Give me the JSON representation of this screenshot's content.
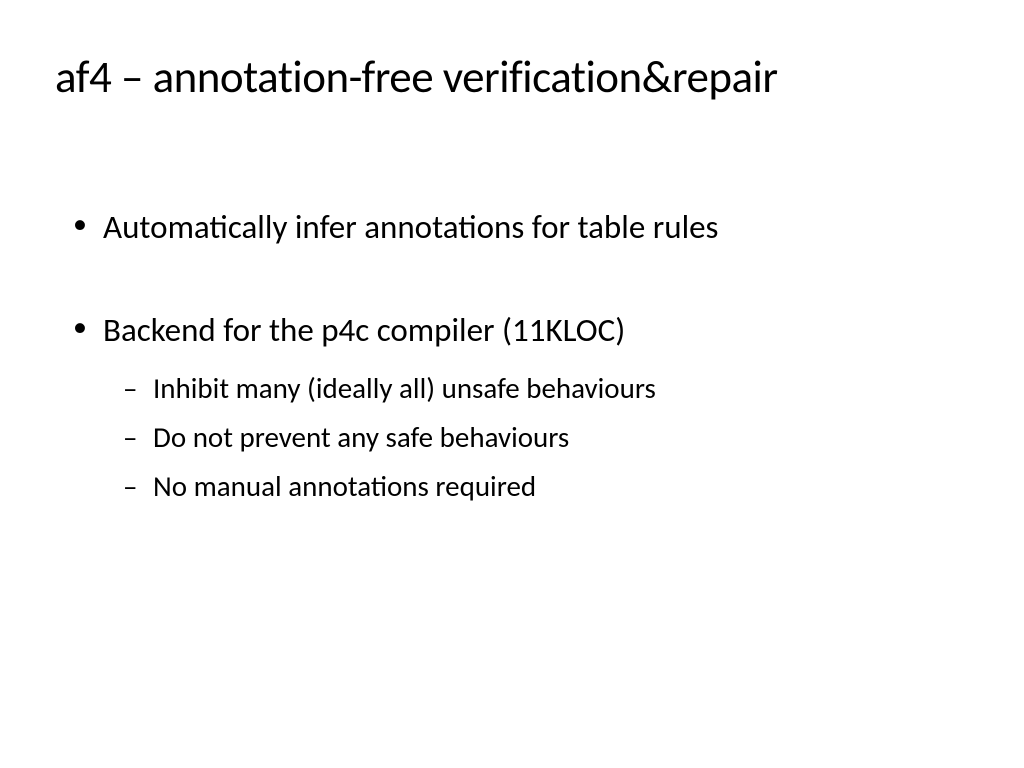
{
  "slide": {
    "title": "af4 – annotation-free verification&repair",
    "bullets": [
      {
        "text": "Automatically infer annotations for table rules",
        "subs": []
      },
      {
        "text": "Backend for the p4c compiler (11KLOC)",
        "subs": [
          "Inhibit many (ideally all) unsafe behaviours",
          "Do not prevent any safe behaviours",
          "No manual annotations required"
        ]
      }
    ]
  }
}
